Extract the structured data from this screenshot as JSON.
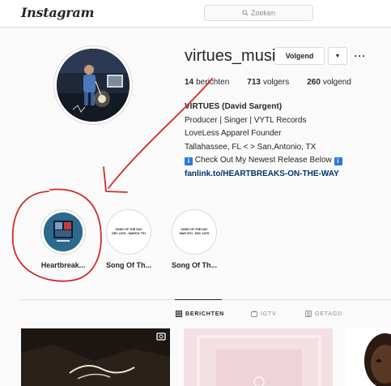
{
  "nav": {
    "logo": "Instagram",
    "search_placeholder": "Zoeken"
  },
  "profile": {
    "username": "virtues_music",
    "follow_label": "Volgend",
    "dropdown_glyph": "▼",
    "more_glyph": "···",
    "stats": [
      {
        "value": "14",
        "label": "berichten"
      },
      {
        "value": "713",
        "label": "volgers"
      },
      {
        "value": "260",
        "label": "volgend"
      }
    ],
    "bio": {
      "name": "VIRTUES (David Sargent)",
      "line1": "Producer | Singer | VYTL Records",
      "line2": "LoveLess Apparel Founder",
      "line3": "Tallahassee, FL < > San,Antonio, TX",
      "line4": "Check Out My Newest Release Below",
      "info_glyph": "i",
      "link": "fanlink.to/HEARTBREAKS-ON-THE-WAY"
    }
  },
  "highlights": [
    {
      "label": "Heartbreak..."
    },
    {
      "label": "Song Of Th...",
      "cover_line1": "SONG OF THE DAY",
      "cover_line2": "DEC 24TH - MARCH 7TH"
    },
    {
      "label": "Song Of Th...",
      "cover_line1": "SONG OF THE DAY",
      "cover_line2": "MAR 9TH - DEC 24TH"
    }
  ],
  "tabs": [
    {
      "label": "BERICHTEN",
      "active": true
    },
    {
      "label": "IGTV",
      "active": false
    },
    {
      "label": "GETAGD",
      "active": false
    }
  ],
  "colors": {
    "annotation_red": "#d42a2a",
    "link": "#003569",
    "border": "#dbdbdb"
  }
}
